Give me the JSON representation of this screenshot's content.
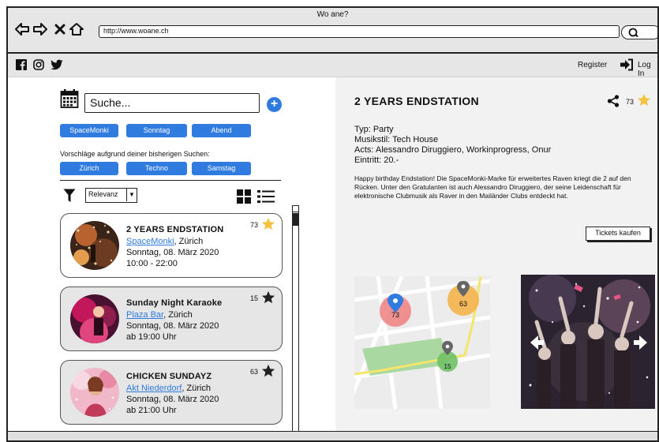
{
  "browser": {
    "title": "Wo ane?",
    "url": "http://www.woane.ch"
  },
  "appbar": {
    "register": "Register",
    "login": "Log In"
  },
  "search": {
    "placeholder": "Suche...",
    "chips": [
      "SpaceMonki",
      "Sonntag",
      "Abend"
    ],
    "suggestions_label": "Vorschläge aufgrund deiner bisherigen Suchen:",
    "suggestions": [
      "Zürich",
      "Techno",
      "Samstag"
    ],
    "sort_value": "Relevanz"
  },
  "events": [
    {
      "title": "2 YEARS ENDSTATION",
      "venue": "SpaceMonki",
      "city": ", Zürich",
      "date": "Sonntag, 08. März 2020",
      "time": "10:00 - 22:00",
      "count": "73",
      "starred": true
    },
    {
      "title": "Sunday Night Karaoke",
      "venue": "Plaza Bar",
      "city": ", Zürich",
      "date": "Sonntag, 08. März 2020",
      "time": "ab 19:00 Uhr",
      "count": "15",
      "starred": false
    },
    {
      "title": "CHICKEN SUNDAYZ",
      "venue": "Akt Niederdorf",
      "city": ", Zürich",
      "date": "Sonntag, 08. März 2020",
      "time": "ab 21:00 Uhr",
      "count": "63",
      "starred": false
    }
  ],
  "detail": {
    "title": "2 YEARS ENDSTATION",
    "count": "73",
    "typ": "Typ: Party",
    "musikstil": "Musikstil: Tech House",
    "acts": "Acts: Alessandro Diruggiero, Workinprogress, Onur",
    "eintritt": "Eintritt: 20.-",
    "description": "Happy birthday Endstation! Die SpaceMonki-Marke für erweitertes Raven kriegt die 2 auf den Rücken. Unter den Gratulanten ist auch Alessandro Diruggiero, der seine Leidenschaft für elektronische Clubmusik als Raver in den Mailänder Clubs entdeckt hat.",
    "tickets_label": "Tickets kaufen"
  },
  "map": {
    "markers": [
      "73",
      "63",
      "15"
    ]
  },
  "colors": {
    "accent": "#2f7be0",
    "star_active": "#f5c242",
    "star_inactive": "#222222",
    "panel_gray": "#e6e6e6"
  }
}
